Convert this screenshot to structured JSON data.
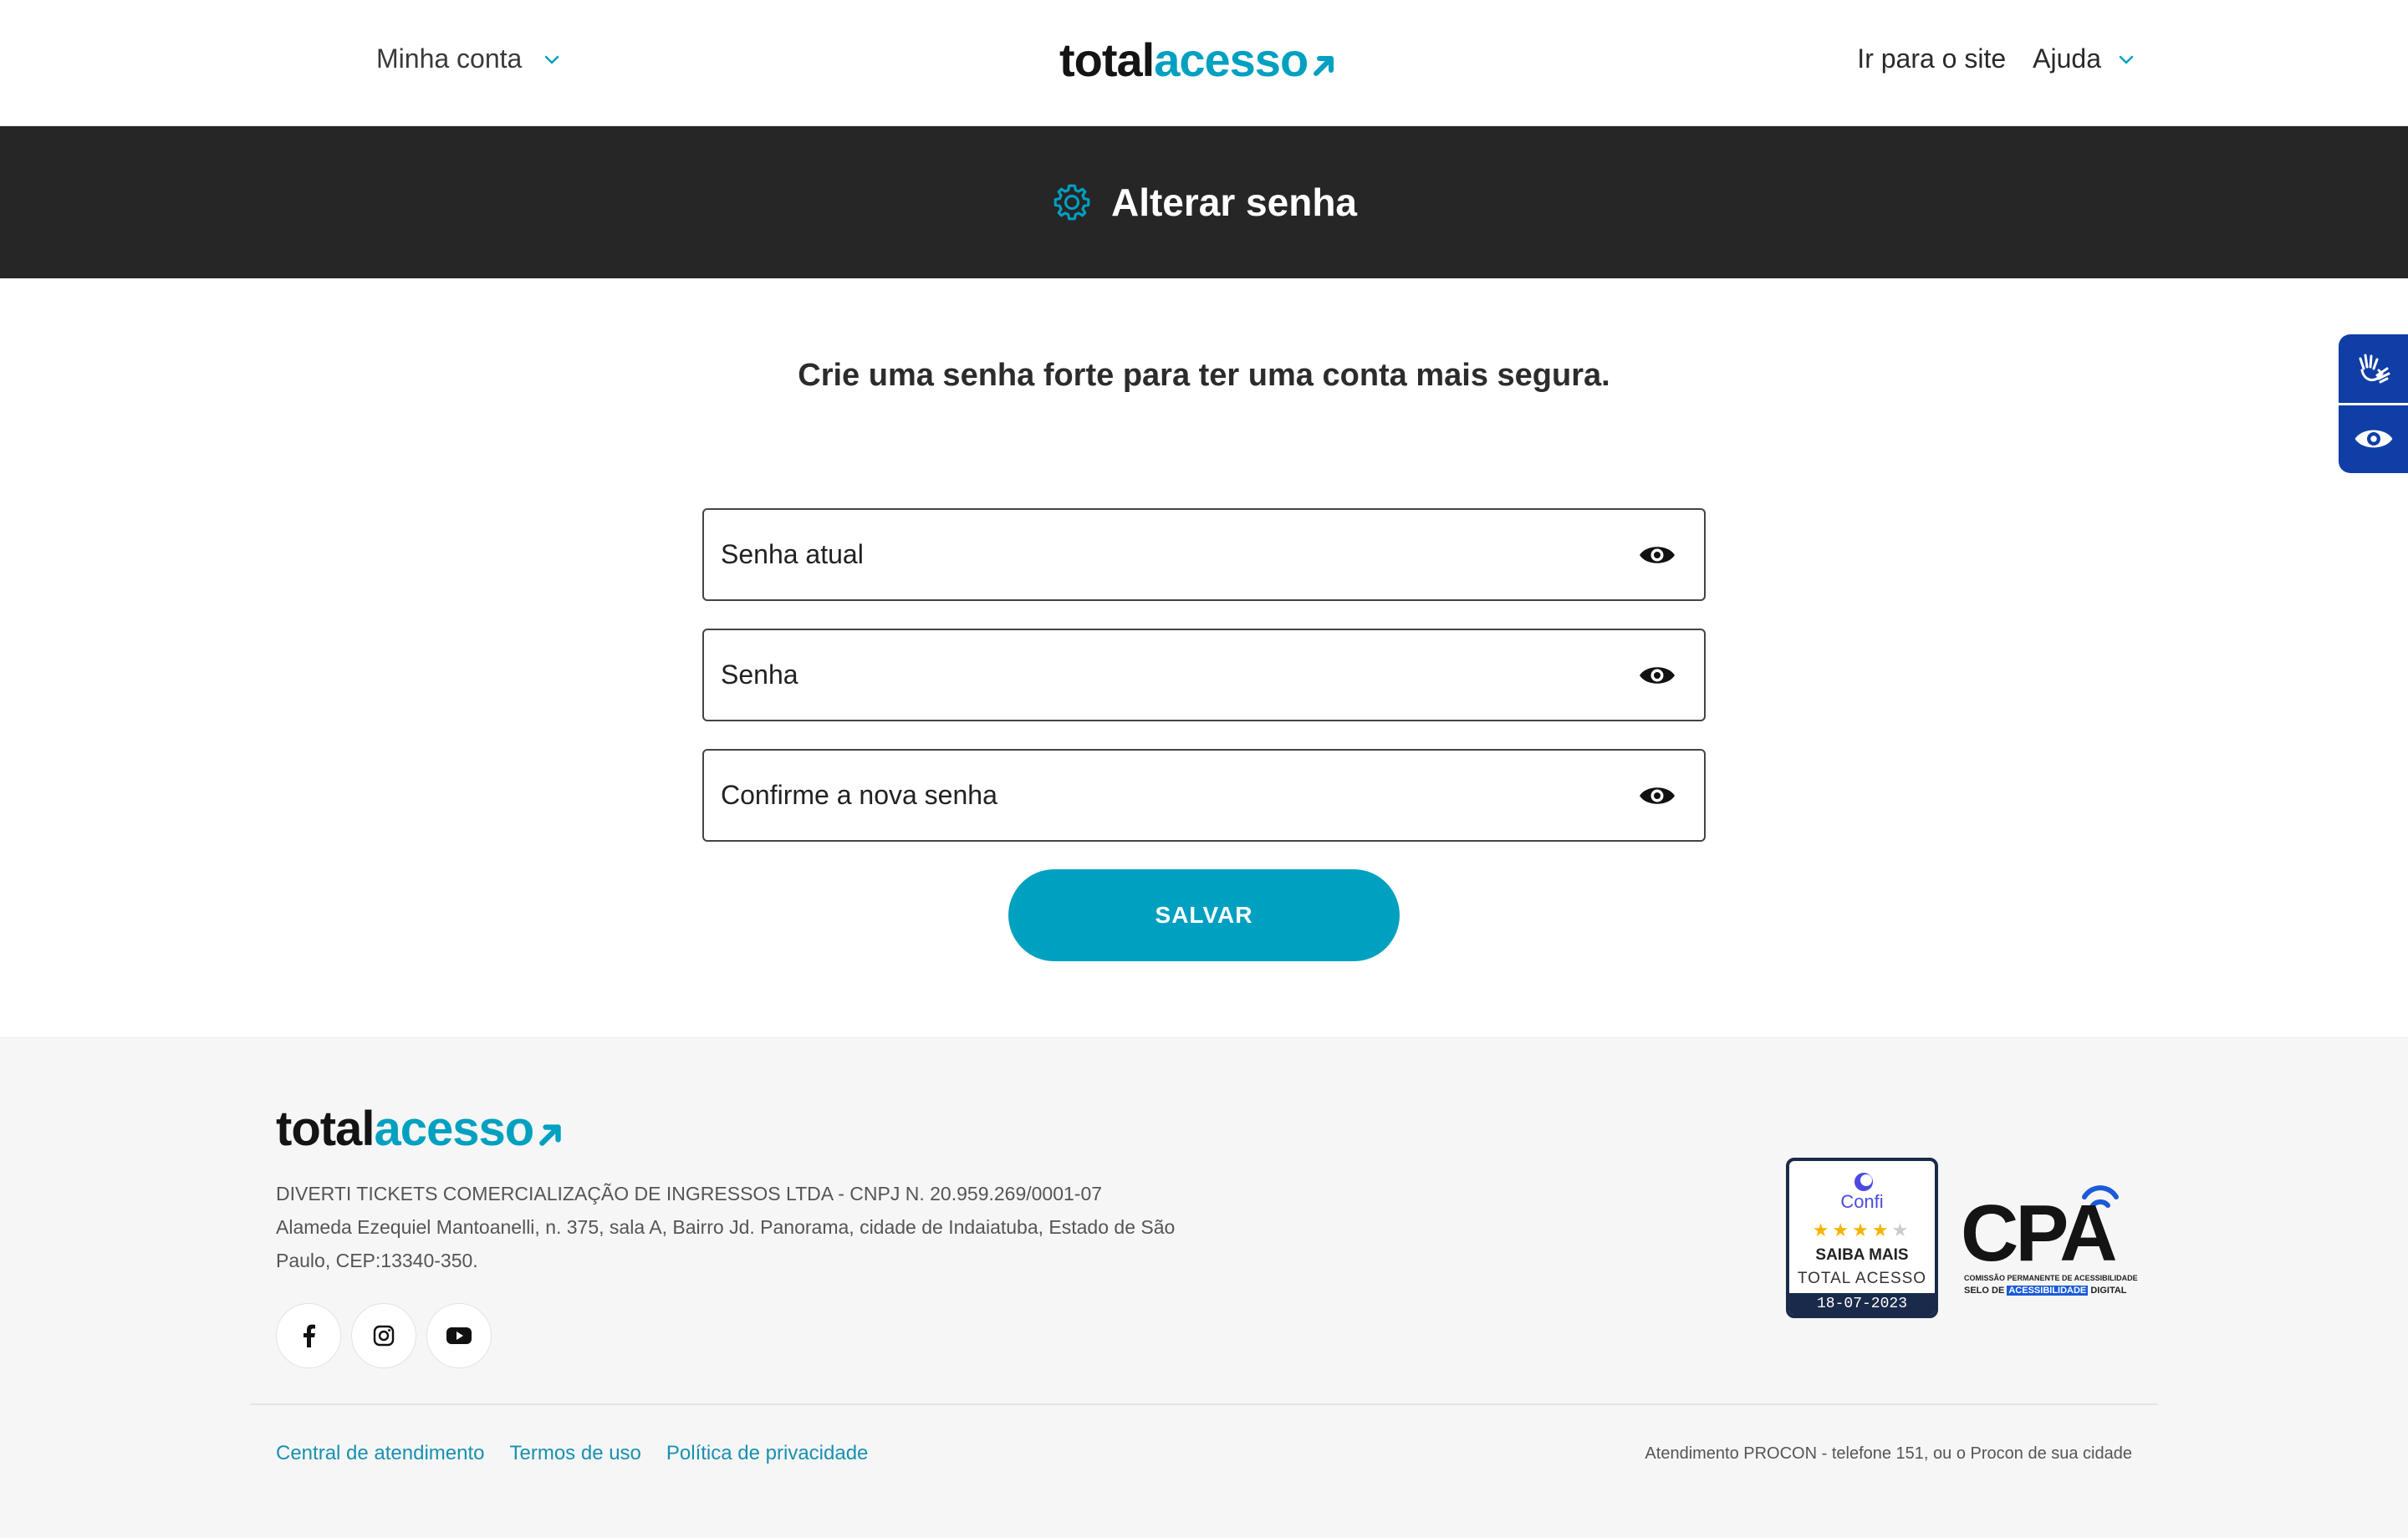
{
  "header": {
    "account_menu_label": "Minha conta",
    "logo": {
      "part1": "total",
      "part2": "acesso"
    },
    "site_link_label": "Ir para o site",
    "help_menu_label": "Ajuda"
  },
  "banner": {
    "title": "Alterar senha",
    "icon": "gear-icon"
  },
  "form": {
    "subtitle": "Crie uma senha forte para ter uma conta mais segura.",
    "current_password_placeholder": "Senha atual",
    "new_password_placeholder": "Senha",
    "confirm_password_placeholder": "Confirme a nova senha",
    "save_label": "SALVAR"
  },
  "accessibility": {
    "items": [
      "sign-language-icon",
      "eye-icon"
    ]
  },
  "footer": {
    "company_line": "DIVERTI TICKETS COMERCIALIZAÇÃO DE INGRESSOS LTDA - CNPJ N. 20.959.269/0001-07",
    "address": "Alameda Ezequiel Mantoanelli, n. 375, sala A, Bairro Jd. Panorama, cidade de Indaiatuba, Estado de São Paulo, CEP:13340-350.",
    "social": [
      "facebook-icon",
      "instagram-icon",
      "youtube-icon"
    ],
    "links": [
      "Central de atendimento",
      "Termos de uso",
      "Política de privacidade"
    ],
    "procon": "Atendimento PROCON - telefone 151, ou o Procon de sua cidade",
    "confi_badge": {
      "brand": "Confi",
      "rating_stars": 4,
      "saiba": "SAIBA MAIS",
      "name": "TOTAL ACESSO",
      "date": "18-07-2023"
    },
    "cpa_badge": {
      "title": "CPA",
      "subtitle1": "COMISSÃO PERMANENTE DE ACESSIBILIDADE",
      "subtitle2_prefix": "SELO DE",
      "subtitle2_highlight": "ACESSIBILIDADE",
      "subtitle2_suffix": "DIGITAL"
    }
  },
  "colors": {
    "accent": "#00a0c0",
    "banner_bg": "#262626",
    "a11y_bg": "#0f3fa6",
    "footer_bg": "#f6f6f6"
  }
}
